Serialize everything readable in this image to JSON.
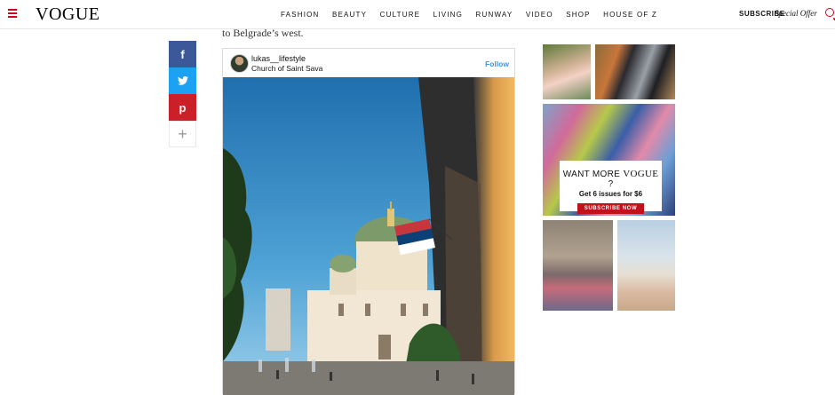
{
  "header": {
    "logo": "VOGUE",
    "nav": [
      "FASHION",
      "BEAUTY",
      "CULTURE",
      "LIVING",
      "RUNWAY",
      "VIDEO",
      "SHOP",
      "HOUSE OF Z"
    ],
    "subscribe": "SUBSCRIBE",
    "special_offer": "Special Offer"
  },
  "article": {
    "text": "to Belgrade’s west."
  },
  "share": {
    "facebook": "f",
    "twitter": "t",
    "pinterest": "p",
    "more": "+"
  },
  "instagram": {
    "username": "lukas__lifestyle",
    "location": "Church of Saint Sava",
    "follow": "Follow"
  },
  "ad": {
    "want_more": "WANT MORE",
    "brand": "VOGUE",
    "question": "?",
    "issues": "Get 6 issues for $6",
    "cta": "SUBSCRIBE NOW"
  },
  "colors": {
    "accent": "#d0021b",
    "facebook": "#3b5998",
    "twitter": "#1da1f2",
    "pinterest": "#cb2027",
    "follow": "#3897f0"
  }
}
